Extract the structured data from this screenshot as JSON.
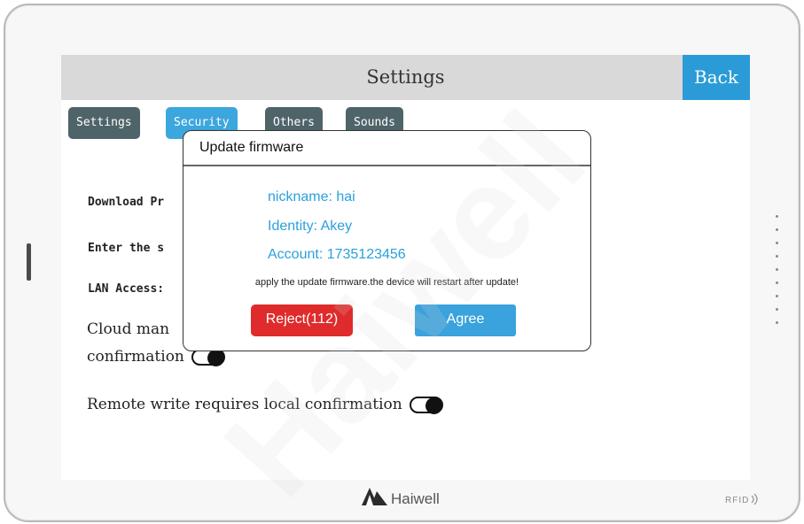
{
  "screen": {
    "title": "Settings",
    "back_label": "Back"
  },
  "tabs": [
    {
      "label": "Settings",
      "active": false
    },
    {
      "label": "Security",
      "active": true
    },
    {
      "label": "Others",
      "active": false
    },
    {
      "label": "Sounds",
      "active": false
    }
  ],
  "security": {
    "download_label": "Download Pr",
    "enter_label": "Enter the s",
    "lan_label": "LAN Access:",
    "cloud_line1": "Cloud man",
    "cloud_line2": "confirmation",
    "cloud_toggle_on": true,
    "remote_write_label": "Remote write requires local confirmation",
    "remote_write_toggle_on": true
  },
  "dialog": {
    "title": "Update firmware",
    "nickname": "nickname: hai",
    "identity": "Identity: Akey",
    "account": "Account: 1735123456",
    "notice": "apply the update firmware.the device will restart after update!",
    "reject_label": "Reject(112)",
    "agree_label": "Agree"
  },
  "device": {
    "brand": "Haiwell",
    "rfid_label": "RFID",
    "watermark": "Haiwell"
  },
  "colors": {
    "accent": "#3ca6de",
    "tab_inactive": "#4e6468",
    "reject": "#df2b2b",
    "titlebar": "#d9d9d9"
  }
}
